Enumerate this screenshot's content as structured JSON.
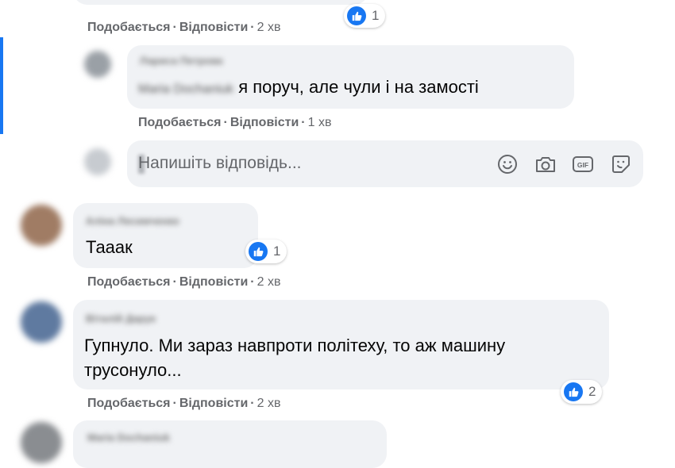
{
  "colors": {
    "accent": "#1877f2",
    "bubble": "#f0f2f5",
    "meta": "#65676b"
  },
  "actions": {
    "like": "Подобається",
    "reply": "Відповісти"
  },
  "comments": [
    {
      "time": "2 хв",
      "reactions": "1"
    },
    {
      "author": "Лариса Петрова",
      "mention": "Maria Dochaniuk",
      "text": "я поруч, але чули і на замості",
      "time": "1 хв"
    },
    {
      "author": "Аліна Лесимченко",
      "text": "Тааак",
      "time": "2 хв",
      "reactions": "1"
    },
    {
      "author": "Віталій Дарук",
      "text_line1": "Гупнуло. Ми зараз навпроти політеху, то аж машину",
      "text_line2": "трусонуло...",
      "time": "2 хв",
      "reactions": "2"
    },
    {
      "author": "Maria Dochaniuk"
    }
  ],
  "reply_box": {
    "placeholder": "Напишіть відповідь...",
    "tools": [
      "emoji-icon",
      "camera-icon",
      "gif-icon",
      "sticker-icon"
    ],
    "gif_label": "GIF"
  }
}
